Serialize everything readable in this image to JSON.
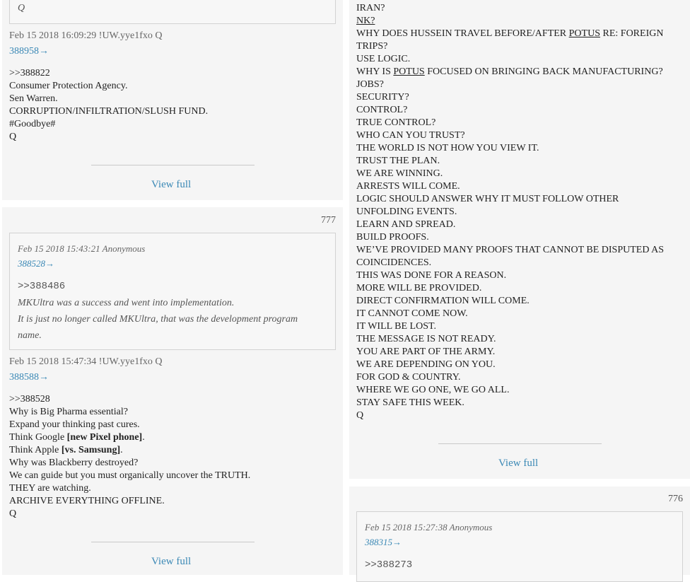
{
  "left": {
    "post_top": {
      "quote_tail": "Q",
      "meta": "Feb 15 2018 16:09:29 !UW.yye1fxo Q",
      "id_link": "388958→",
      "lines": [
        "&gt;&gt;388822",
        "Consumer Protection Agency.",
        "Sen Warren.",
        "CORRUPTION/INFILTRATION/SLUSH FUND.",
        "#Goodbye#",
        "Q"
      ],
      "view_full": "View full"
    },
    "post_777": {
      "number": "777",
      "quote_meta": "Feb 15 2018 15:43:21 Anonymous",
      "quote_link": "388528→",
      "quote_lines": [
        ">>388486",
        "MKUltra was a success and went into implementation.",
        "It is just no longer called MKUltra, that was the development program",
        "name."
      ],
      "meta": "Feb 15 2018 15:47:34 !UW.yye1fxo Q",
      "id_link": "388588→",
      "line1": ">>388528",
      "line2": "Why is Big Pharma essential?",
      "line3": "Expand your thinking past cures.",
      "line4_pre": "Think Google ",
      "line4_bold": "[new Pixel phone]",
      "line4_post": ".",
      "line5_pre": "Think Apple ",
      "line5_bold": "[vs. Samsung]",
      "line5_post": ".",
      "line6": "Why was Blackberry destroyed?",
      "line7": "We can guide but you must organically uncover the TRUTH.",
      "line8": "THEY are watching.",
      "line9": "ARCHIVE EVERYTHING OFFLINE.",
      "line10": "Q",
      "view_full": "View full"
    }
  },
  "right": {
    "post_top": {
      "l01": "IRAN?",
      "l02": "NK?",
      "l03_pre": "WHY DOES HUSSEIN TRAVEL BEFORE/AFTER ",
      "l03_ul": "POTUS",
      "l03_post": " RE: FOREIGN",
      "l04": "TRIPS?",
      "l05": "USE LOGIC.",
      "l06_pre": "WHY IS ",
      "l06_ul": "POTUS",
      "l06_post": " FOCUSED ON BRINGING BACK MANUFACTURING?",
      "l07": "JOBS?",
      "l08": "SECURITY?",
      "l09": "CONTROL?",
      "l10": "TRUE CONTROL?",
      "l11": "WHO CAN YOU TRUST?",
      "l12": "THE WORLD IS NOT HOW YOU VIEW IT.",
      "l13": "TRUST THE PLAN.",
      "l14": "WE ARE WINNING.",
      "l15": "ARRESTS WILL COME.",
      "l16": "LOGIC SHOULD ANSWER WHY IT MUST FOLLOW OTHER",
      "l17": "UNFOLDING EVENTS.",
      "l18": "LEARN AND SPREAD.",
      "l19": "BUILD PROOFS.",
      "l20": "WE’VE PROVIDED MANY PROOFS THAT CANNOT BE DISPUTED AS",
      "l21": "COINCIDENCES.",
      "l22": "THIS WAS DONE FOR A REASON.",
      "l23": "MORE WILL BE PROVIDED.",
      "l24": "DIRECT CONFIRMATION WILL COME.",
      "l25": "IT CANNOT COME NOW.",
      "l26": "IT WILL BE LOST.",
      "l27": "THE MESSAGE IS NOT READY.",
      "l28": "YOU ARE PART OF THE ARMY.",
      "l29": "WE ARE DEPENDING ON YOU.",
      "l30": "FOR GOD & COUNTRY.",
      "l31": "WHERE WE GO ONE, WE GO ALL.",
      "l32": "STAY SAFE THIS WEEK.",
      "l33": "Q",
      "view_full": "View full"
    },
    "post_776": {
      "number": "776",
      "quote_meta": "Feb 15 2018 15:27:38 Anonymous",
      "quote_link": "388315→",
      "quote_line": ">>388273"
    }
  }
}
